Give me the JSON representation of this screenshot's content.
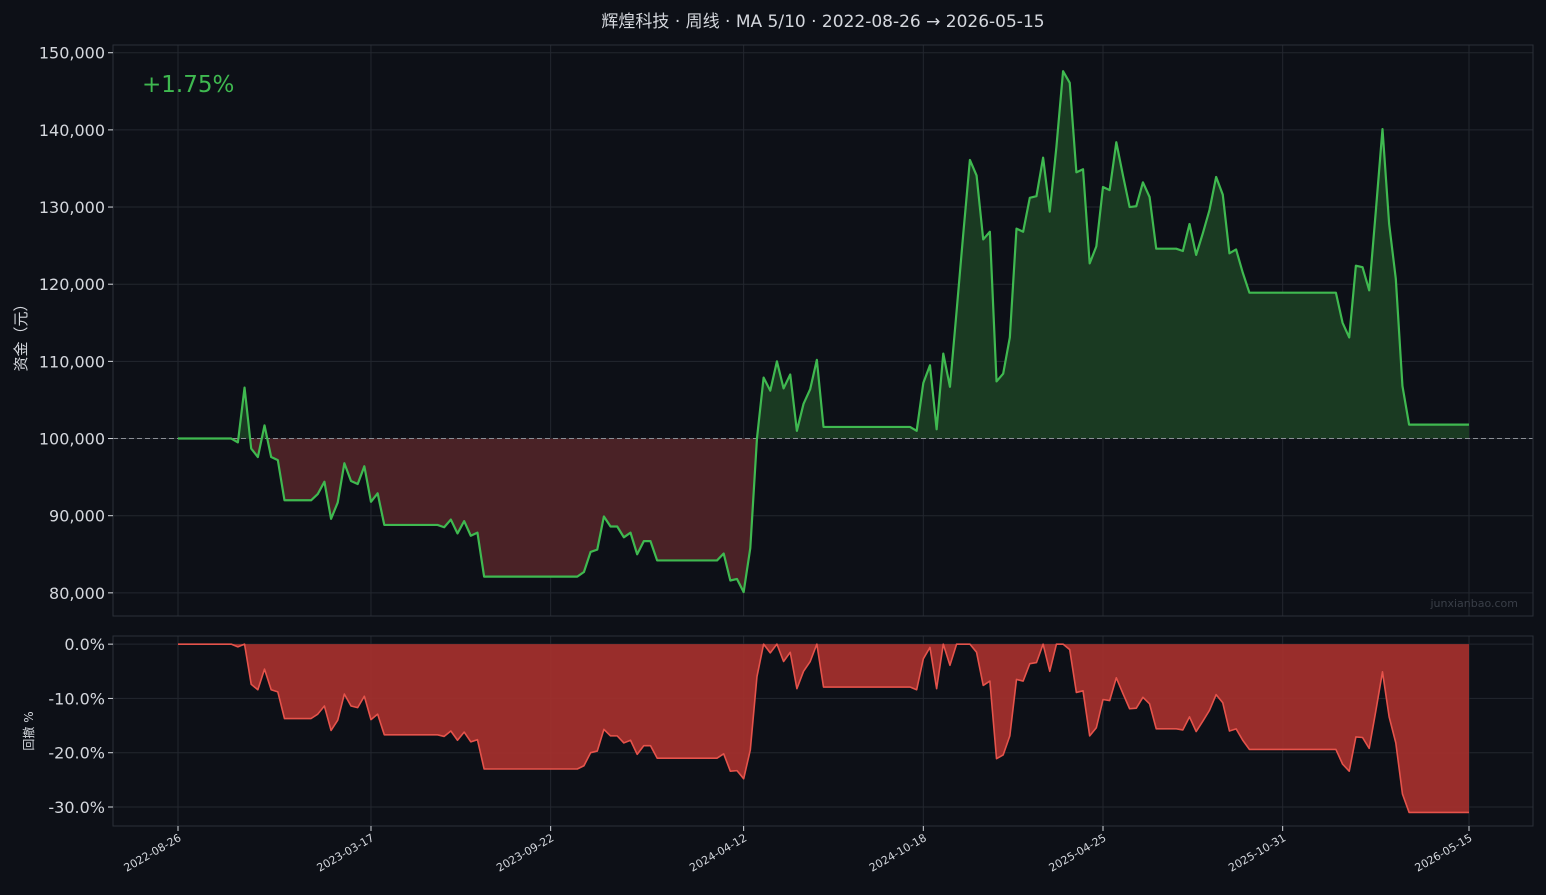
{
  "colors": {
    "background": "#0d1017",
    "grid": "#23272f",
    "frame": "#2b3038",
    "text": "#d4d7dd",
    "equity_line": "#3fb950",
    "gain_fill": "#1a3a22",
    "loss_fill": "#4a2226",
    "drawdown_line": "#e5534b",
    "drawdown_fill": "#a8312d",
    "baseline": "#8b8f96"
  },
  "chart_data": [
    {
      "type": "line",
      "title": "辉煌科技 · 周线 · MA 5/10 · 2022-08-26 → 2026-05-15",
      "ylabel": "资金（元）",
      "annotation": "+1.75%",
      "watermark": "junxianbao.com",
      "baseline": 100000,
      "ylim": [
        77000,
        151000
      ],
      "yticks": [
        80000,
        90000,
        100000,
        110000,
        120000,
        130000,
        140000,
        150000
      ],
      "ytick_labels": [
        "80,000",
        "90,000",
        "100,000",
        "110,000",
        "120,000",
        "130,000",
        "140,000",
        "150,000"
      ],
      "x_range": [
        "2022-08-26",
        "2026-05-15"
      ],
      "xtick_labels": [
        "2022-08-26",
        "2023-03-17",
        "2023-09-22",
        "2024-04-12",
        "2024-10-18",
        "2025-04-25",
        "2025-10-31",
        "2026-05-15"
      ],
      "grid": true,
      "points": [
        [
          "2022-08-26",
          100000
        ],
        [
          "2022-10-21",
          100000
        ],
        [
          "2022-10-28",
          99500
        ],
        [
          "2022-11-04",
          106600
        ],
        [
          "2022-11-11",
          98700
        ],
        [
          "2022-11-18",
          97600
        ],
        [
          "2022-11-25",
          101700
        ],
        [
          "2022-12-02",
          97600
        ],
        [
          "2022-12-09",
          97200
        ],
        [
          "2022-12-16",
          92000
        ],
        [
          "2023-01-13",
          92000
        ],
        [
          "2023-01-20",
          92800
        ],
        [
          "2023-01-27",
          94400
        ],
        [
          "2023-02-03",
          89600
        ],
        [
          "2023-02-10",
          91700
        ],
        [
          "2023-02-17",
          96800
        ],
        [
          "2023-02-24",
          94500
        ],
        [
          "2023-03-03",
          94100
        ],
        [
          "2023-03-10",
          96400
        ],
        [
          "2023-03-17",
          91800
        ],
        [
          "2023-03-24",
          92900
        ],
        [
          "2023-03-31",
          88800
        ],
        [
          "2023-05-26",
          88800
        ],
        [
          "2023-06-02",
          88500
        ],
        [
          "2023-06-09",
          89500
        ],
        [
          "2023-06-16",
          87700
        ],
        [
          "2023-06-23",
          89300
        ],
        [
          "2023-06-30",
          87400
        ],
        [
          "2023-07-07",
          87800
        ],
        [
          "2023-07-14",
          82100
        ],
        [
          "2023-10-20",
          82100
        ],
        [
          "2023-10-27",
          82700
        ],
        [
          "2023-11-03",
          85300
        ],
        [
          "2023-11-10",
          85600
        ],
        [
          "2023-11-17",
          89900
        ],
        [
          "2023-11-24",
          88600
        ],
        [
          "2023-12-01",
          88600
        ],
        [
          "2023-12-08",
          87200
        ],
        [
          "2023-12-15",
          87800
        ],
        [
          "2023-12-22",
          85000
        ],
        [
          "2023-12-29",
          86700
        ],
        [
          "2024-01-05",
          86700
        ],
        [
          "2024-01-12",
          84200
        ],
        [
          "2024-03-15",
          84200
        ],
        [
          "2024-03-22",
          85100
        ],
        [
          "2024-03-29",
          81600
        ],
        [
          "2024-04-05",
          81800
        ],
        [
          "2024-04-12",
          80100
        ],
        [
          "2024-04-19",
          85800
        ],
        [
          "2024-04-26",
          100000
        ],
        [
          "2024-05-03",
          107900
        ],
        [
          "2024-05-10",
          106200
        ],
        [
          "2024-05-17",
          110000
        ],
        [
          "2024-05-24",
          106500
        ],
        [
          "2024-05-31",
          108300
        ],
        [
          "2024-06-07",
          101000
        ],
        [
          "2024-06-14",
          104500
        ],
        [
          "2024-06-21",
          106400
        ],
        [
          "2024-06-28",
          110200
        ],
        [
          "2024-07-05",
          101500
        ],
        [
          "2024-10-04",
          101500
        ],
        [
          "2024-10-11",
          101000
        ],
        [
          "2024-10-18",
          107200
        ],
        [
          "2024-10-25",
          109500
        ],
        [
          "2024-11-01",
          101200
        ],
        [
          "2024-11-08",
          111000
        ],
        [
          "2024-11-15",
          106700
        ],
        [
          "2024-11-22",
          116500
        ],
        [
          "2024-11-29",
          126500
        ],
        [
          "2024-12-06",
          136100
        ],
        [
          "2024-12-13",
          134100
        ],
        [
          "2024-12-20",
          125800
        ],
        [
          "2024-12-27",
          126800
        ],
        [
          "2025-01-03",
          107400
        ],
        [
          "2025-01-10",
          108400
        ],
        [
          "2025-01-17",
          113100
        ],
        [
          "2025-01-24",
          127200
        ],
        [
          "2025-01-31",
          126800
        ],
        [
          "2025-02-07",
          131200
        ],
        [
          "2025-02-14",
          131400
        ],
        [
          "2025-02-21",
          136400
        ],
        [
          "2025-02-28",
          129400
        ],
        [
          "2025-03-07",
          137800
        ],
        [
          "2025-03-14",
          147600
        ],
        [
          "2025-03-21",
          146100
        ],
        [
          "2025-03-28",
          134500
        ],
        [
          "2025-04-04",
          134900
        ],
        [
          "2025-04-11",
          122700
        ],
        [
          "2025-04-18",
          124900
        ],
        [
          "2025-04-25",
          132600
        ],
        [
          "2025-05-02",
          132200
        ],
        [
          "2025-05-09",
          138400
        ],
        [
          "2025-05-16",
          134100
        ],
        [
          "2025-05-23",
          130000
        ],
        [
          "2025-05-30",
          130100
        ],
        [
          "2025-06-06",
          133200
        ],
        [
          "2025-06-13",
          131300
        ],
        [
          "2025-06-20",
          124600
        ],
        [
          "2025-07-11",
          124600
        ],
        [
          "2025-07-18",
          124300
        ],
        [
          "2025-07-25",
          127800
        ],
        [
          "2025-08-01",
          123800
        ],
        [
          "2025-08-08",
          126600
        ],
        [
          "2025-08-15",
          129600
        ],
        [
          "2025-08-22",
          133900
        ],
        [
          "2025-08-29",
          131600
        ],
        [
          "2025-09-05",
          124000
        ],
        [
          "2025-09-12",
          124500
        ],
        [
          "2025-09-19",
          121500
        ],
        [
          "2025-09-26",
          118900
        ],
        [
          "2025-12-26",
          118900
        ],
        [
          "2026-01-02",
          115000
        ],
        [
          "2026-01-09",
          113100
        ],
        [
          "2026-01-16",
          122400
        ],
        [
          "2026-01-23",
          122200
        ],
        [
          "2026-01-30",
          119200
        ],
        [
          "2026-02-06",
          129500
        ],
        [
          "2026-02-13",
          140100
        ],
        [
          "2026-02-20",
          127800
        ],
        [
          "2026-02-27",
          120700
        ],
        [
          "2026-03-06",
          106800
        ],
        [
          "2026-03-13",
          101800
        ],
        [
          "2026-05-15",
          101800
        ]
      ]
    },
    {
      "type": "area",
      "ylabel": "回撤 %",
      "ylim": [
        -33.5,
        1.5
      ],
      "yticks": [
        0,
        -10,
        -20,
        -30
      ],
      "ytick_labels": [
        "0.0%",
        "-10.0%",
        "-20.0%",
        "-30.0%"
      ],
      "x_range": [
        "2022-08-26",
        "2026-05-15"
      ],
      "grid": true,
      "points": [
        [
          "2022-08-26",
          0
        ],
        [
          "2022-10-21",
          0
        ],
        [
          "2022-10-28",
          -0.5
        ],
        [
          "2022-11-04",
          0
        ],
        [
          "2022-11-11",
          -7.4
        ],
        [
          "2022-11-18",
          -8.4
        ],
        [
          "2022-11-25",
          -4.6
        ],
        [
          "2022-12-02",
          -8.4
        ],
        [
          "2022-12-09",
          -8.8
        ],
        [
          "2022-12-16",
          -13.7
        ],
        [
          "2023-01-13",
          -13.7
        ],
        [
          "2023-01-20",
          -12.9
        ],
        [
          "2023-01-27",
          -11.4
        ],
        [
          "2023-02-03",
          -15.9
        ],
        [
          "2023-02-10",
          -14.0
        ],
        [
          "2023-02-17",
          -9.2
        ],
        [
          "2023-02-24",
          -11.4
        ],
        [
          "2023-03-03",
          -11.7
        ],
        [
          "2023-03-10",
          -9.6
        ],
        [
          "2023-03-17",
          -13.9
        ],
        [
          "2023-03-24",
          -12.9
        ],
        [
          "2023-03-31",
          -16.7
        ],
        [
          "2023-05-26",
          -16.7
        ],
        [
          "2023-06-02",
          -17.0
        ],
        [
          "2023-06-09",
          -16.0
        ],
        [
          "2023-06-16",
          -17.7
        ],
        [
          "2023-06-23",
          -16.2
        ],
        [
          "2023-06-30",
          -18.0
        ],
        [
          "2023-07-07",
          -17.6
        ],
        [
          "2023-07-14",
          -23.0
        ],
        [
          "2023-10-20",
          -23.0
        ],
        [
          "2023-10-27",
          -22.4
        ],
        [
          "2023-11-03",
          -20.0
        ],
        [
          "2023-11-10",
          -19.7
        ],
        [
          "2023-11-17",
          -15.7
        ],
        [
          "2023-11-24",
          -16.9
        ],
        [
          "2023-12-01",
          -16.9
        ],
        [
          "2023-12-08",
          -18.2
        ],
        [
          "2023-12-15",
          -17.7
        ],
        [
          "2023-12-22",
          -20.3
        ],
        [
          "2023-12-29",
          -18.7
        ],
        [
          "2024-01-05",
          -18.7
        ],
        [
          "2024-01-12",
          -21.0
        ],
        [
          "2024-03-15",
          -21.0
        ],
        [
          "2024-03-22",
          -20.2
        ],
        [
          "2024-03-29",
          -23.4
        ],
        [
          "2024-04-05",
          -23.3
        ],
        [
          "2024-04-12",
          -24.8
        ],
        [
          "2024-04-19",
          -19.5
        ],
        [
          "2024-04-26",
          -6.0
        ],
        [
          "2024-05-03",
          0
        ],
        [
          "2024-05-10",
          -1.6
        ],
        [
          "2024-05-17",
          0
        ],
        [
          "2024-05-24",
          -3.2
        ],
        [
          "2024-05-31",
          -1.5
        ],
        [
          "2024-06-07",
          -8.2
        ],
        [
          "2024-06-14",
          -5.0
        ],
        [
          "2024-06-21",
          -3.2
        ],
        [
          "2024-06-28",
          0
        ],
        [
          "2024-07-05",
          -7.9
        ],
        [
          "2024-10-04",
          -7.9
        ],
        [
          "2024-10-11",
          -8.4
        ],
        [
          "2024-10-18",
          -2.7
        ],
        [
          "2024-10-25",
          -0.6
        ],
        [
          "2024-11-01",
          -8.2
        ],
        [
          "2024-11-08",
          0
        ],
        [
          "2024-11-15",
          -3.9
        ],
        [
          "2024-11-22",
          0
        ],
        [
          "2024-11-29",
          0
        ],
        [
          "2024-12-06",
          0
        ],
        [
          "2024-12-13",
          -1.5
        ],
        [
          "2024-12-20",
          -7.6
        ],
        [
          "2024-12-27",
          -6.8
        ],
        [
          "2025-01-03",
          -21.1
        ],
        [
          "2025-01-10",
          -20.4
        ],
        [
          "2025-01-17",
          -16.9
        ],
        [
          "2025-01-24",
          -6.5
        ],
        [
          "2025-01-31",
          -6.8
        ],
        [
          "2025-02-07",
          -3.6
        ],
        [
          "2025-02-14",
          -3.4
        ],
        [
          "2025-02-21",
          0
        ],
        [
          "2025-02-28",
          -5.0
        ],
        [
          "2025-03-07",
          0
        ],
        [
          "2025-03-14",
          0
        ],
        [
          "2025-03-21",
          -1.0
        ],
        [
          "2025-03-28",
          -8.9
        ],
        [
          "2025-04-04",
          -8.6
        ],
        [
          "2025-04-11",
          -16.9
        ],
        [
          "2025-04-18",
          -15.4
        ],
        [
          "2025-04-25",
          -10.2
        ],
        [
          "2025-05-02",
          -10.4
        ],
        [
          "2025-05-09",
          -6.2
        ],
        [
          "2025-05-16",
          -9.1
        ],
        [
          "2025-05-23",
          -11.9
        ],
        [
          "2025-05-30",
          -11.8
        ],
        [
          "2025-06-06",
          -9.8
        ],
        [
          "2025-06-13",
          -11.0
        ],
        [
          "2025-06-20",
          -15.6
        ],
        [
          "2025-07-11",
          -15.6
        ],
        [
          "2025-07-18",
          -15.8
        ],
        [
          "2025-07-25",
          -13.4
        ],
        [
          "2025-08-01",
          -16.1
        ],
        [
          "2025-08-08",
          -14.2
        ],
        [
          "2025-08-15",
          -12.2
        ],
        [
          "2025-08-22",
          -9.3
        ],
        [
          "2025-08-29",
          -10.8
        ],
        [
          "2025-09-05",
          -16.0
        ],
        [
          "2025-09-12",
          -15.6
        ],
        [
          "2025-09-19",
          -17.7
        ],
        [
          "2025-09-26",
          -19.4
        ],
        [
          "2025-12-26",
          -19.4
        ],
        [
          "2026-01-02",
          -22.1
        ],
        [
          "2026-01-09",
          -23.4
        ],
        [
          "2026-01-16",
          -17.1
        ],
        [
          "2026-01-23",
          -17.2
        ],
        [
          "2026-01-30",
          -19.2
        ],
        [
          "2026-02-06",
          -12.3
        ],
        [
          "2026-02-13",
          -5.1
        ],
        [
          "2026-02-20",
          -13.4
        ],
        [
          "2026-02-27",
          -18.2
        ],
        [
          "2026-03-06",
          -27.6
        ],
        [
          "2026-03-13",
          -31.0
        ],
        [
          "2026-05-15",
          -31.0
        ]
      ]
    }
  ]
}
